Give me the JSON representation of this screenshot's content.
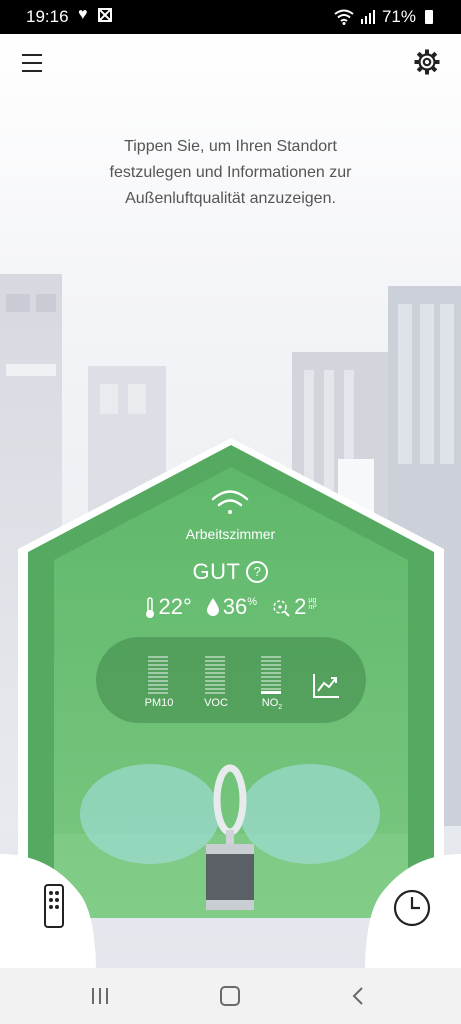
{
  "status_bar": {
    "time": "19:16",
    "battery": "71%"
  },
  "header": {
    "menu_icon": "hamburger-menu-icon",
    "settings_icon": "gear-icon"
  },
  "location_prompt": {
    "line1": "Tippen Sie, um Ihren Standort",
    "line2": "festzulegen und Informationen zur",
    "line3": "Außenluftqualität anzuzeigen."
  },
  "room": {
    "name": "Arbeitszimmer",
    "quality": "GUT",
    "temperature": "22°",
    "humidity": "36",
    "humidity_unit": "%",
    "particles": "2",
    "particles_unit_top": "µg",
    "particles_unit_bottom": "m³"
  },
  "pollutants": {
    "pm10": {
      "label": "PM10",
      "level": 0
    },
    "voc": {
      "label": "VOC",
      "level": 0
    },
    "no2": {
      "label": "NO",
      "sub": "2",
      "level": 0.1
    }
  },
  "colors": {
    "house_green": "#5cb767",
    "room_green": "#6dbf75",
    "text": "#ffffff"
  },
  "icons": [
    "wifi-icon",
    "thermometer-icon",
    "droplet-icon",
    "particles-icon",
    "trend-chart-icon",
    "remote-control-icon",
    "clock-icon"
  ]
}
